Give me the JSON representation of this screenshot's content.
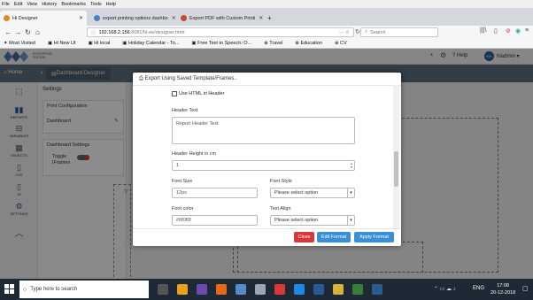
{
  "menu": [
    "File",
    "Edit",
    "View",
    "History",
    "Bookmarks",
    "Tools",
    "Help"
  ],
  "tabs": [
    {
      "label": "Hi Designer",
      "color": "#e08a1e"
    },
    {
      "label": "export printing options dashbo",
      "color": "#4a7fc1"
    },
    {
      "label": "Export PDF with Custom Printi",
      "color": "#c74634"
    }
  ],
  "url": {
    "host": "192.168.2.156",
    "path": ":8081/hi-ee/designer.html"
  },
  "search_placeholder": "Search",
  "bookmarks": [
    "Most Visited",
    "Hi New UI",
    "Hi local",
    "Holiday Calendar - To...",
    "Free Text to Speech: O...",
    "Travel",
    "Education",
    "CV"
  ],
  "app": {
    "logo_line1": "ENTERPRISE",
    "logo_line2": "EDITION",
    "help": "Help",
    "user_initials": "HA",
    "user_name": "hiadmin",
    "home": "Home",
    "toolbar_title": "Dashboard Designer"
  },
  "sidebar": [
    "REPORTS",
    "VARIABLES",
    "OBJECTS",
    "CSS",
    "JS",
    "SETTINGS"
  ],
  "settings": {
    "title": "Settings",
    "print_config": "Print Configuration",
    "dashboard": "Dashboard",
    "dashboard_settings": "Dashboard Settings",
    "toggle_label1": "Toggle",
    "toggle_label2": "IFrames"
  },
  "modal": {
    "title": "Export Using Saved Template/Frames..",
    "checkbox_label": "Use HTML in Header",
    "header_text_label": "Header Text",
    "header_text_value": "Report Header Text",
    "header_height_label": "Header Height in cm",
    "header_height_value": "1",
    "font_size_label": "Font Size",
    "font_size_value": "12px",
    "font_style_label": "Font Style",
    "font_style_value": "Please select option",
    "font_color_label": "Font color",
    "font_color_value": "#0f0f0f",
    "text_align_label": "Text Align",
    "text_align_value": "Please select option",
    "close_label": "Close",
    "edit_label": "Edit Format",
    "apply_label": "Apply Format"
  },
  "taskbar": {
    "search_placeholder": "Type here to search",
    "lang": "ENG",
    "time": "17:08",
    "date": "20-12-2018"
  },
  "colors": {
    "toolbar": "#5e6f7e",
    "close": "#d9383a",
    "edit": "#3a8fd6",
    "apply": "#3a8fd6"
  }
}
